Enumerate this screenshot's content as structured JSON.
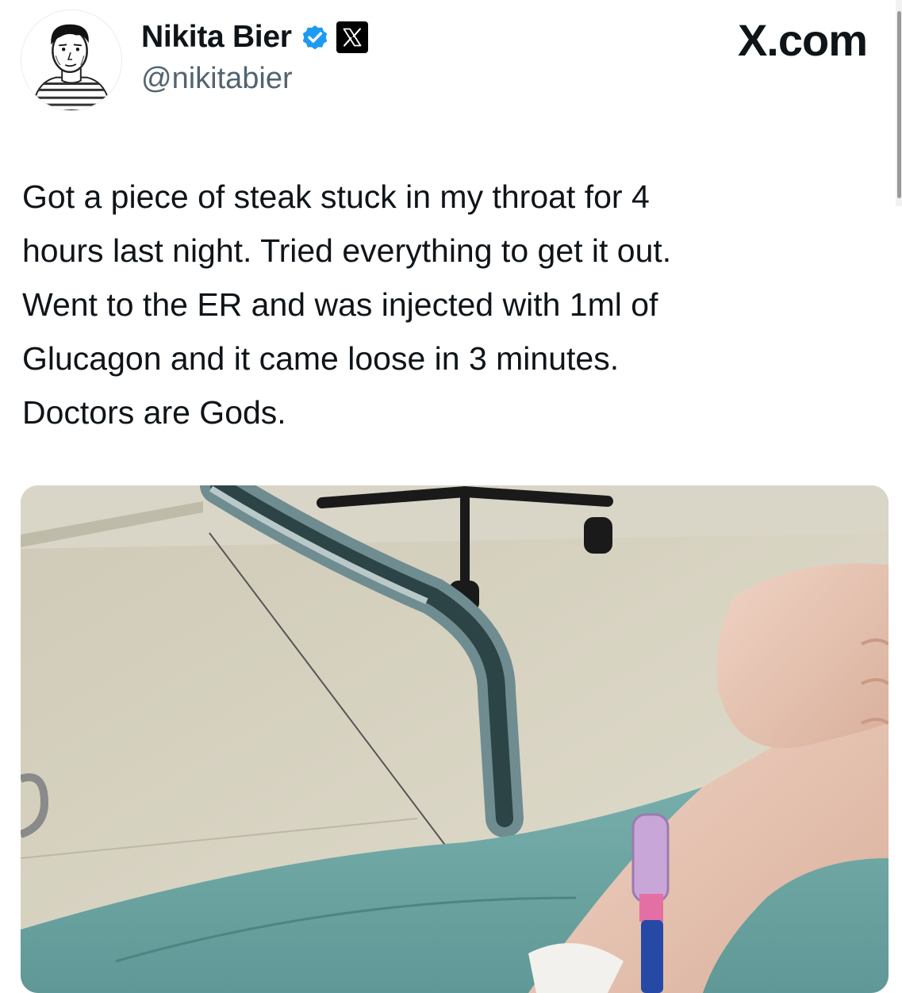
{
  "author": {
    "name": "Nikita Bier",
    "handle": "@nikitabier",
    "avatar_icon": "sketched-person-avatar",
    "verified_icon": "verified-badge-icon",
    "affiliation_icon": "x-logo-icon"
  },
  "brand": "X.com",
  "tweet": {
    "text": "Got a piece of steak stuck in my throat for 4\nhours last night. Tried everything to get it out.\nWent to the ER and was injected with 1ml of\nGlucagon and it came loose in 3 minutes.\nDoctors are Gods."
  },
  "colors": {
    "verified": "#1d9bf0",
    "text": "#0f1419",
    "secondary": "#536471",
    "background": "#ffffff"
  }
}
